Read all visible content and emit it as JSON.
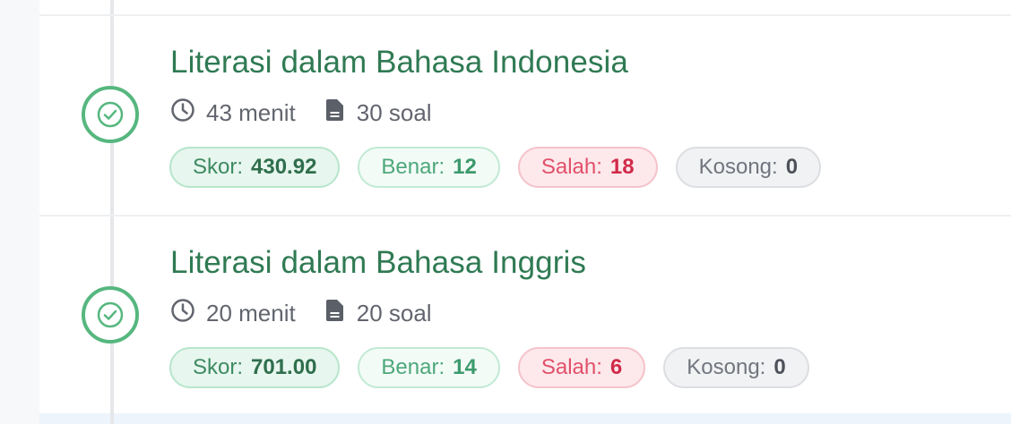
{
  "sections": [
    {
      "title": "Literasi dalam Bahasa Indonesia",
      "duration": "43 menit",
      "questions": "30 soal",
      "stats": {
        "skor_label": "Skor:",
        "skor": "430.92",
        "benar_label": "Benar:",
        "benar": "12",
        "salah_label": "Salah:",
        "salah": "18",
        "kosong_label": "Kosong:",
        "kosong": "0"
      }
    },
    {
      "title": "Literasi dalam Bahasa Inggris",
      "duration": "20 menit",
      "questions": "20 soal",
      "stats": {
        "skor_label": "Skor:",
        "skor": "701.00",
        "benar_label": "Benar:",
        "benar": "14",
        "salah_label": "Salah:",
        "salah": "6",
        "kosong_label": "Kosong:",
        "kosong": "0"
      }
    }
  ],
  "icons": {
    "status": "check-circle-icon",
    "duration": "clock-icon",
    "questions": "document-icon"
  },
  "colors": {
    "accent": "#2f7a53",
    "status_ring": "#56b77f",
    "correct": "#3c9a6c",
    "wrong": "#d02b4a",
    "empty": "#4d515a"
  }
}
